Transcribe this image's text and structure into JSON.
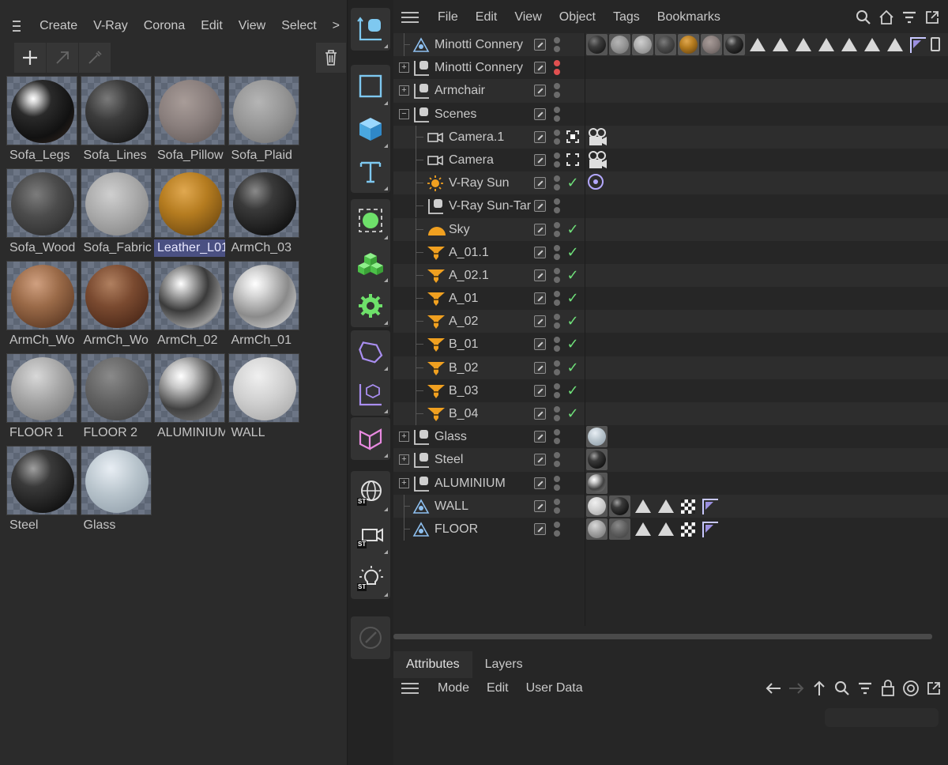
{
  "material_manager": {
    "menu": [
      "Create",
      "V-Ray",
      "Corona",
      "Edit",
      "View",
      "Select"
    ],
    "menu_more": ">",
    "toolbar": {
      "add_icon": "plus-icon",
      "arrow_icon": "arrow-up-right-icon",
      "picker_icon": "eyedropper-icon",
      "trash_icon": "trash-icon"
    },
    "materials": [
      {
        "label": "Sofa_Legs",
        "sphere": "radial-gradient(circle at 35% 30%, #ffffff 0%, #d0d0d0 8%, #2a2a2a 30%, #111 65%, #3a2a20 100%)"
      },
      {
        "label": "Sofa_Lines",
        "sphere": "radial-gradient(circle at 35% 30%, #7a7a7a 0%, #3c3c3c 35%, #1a1a1a 80%)"
      },
      {
        "label": "Sofa_Pillow",
        "sphere": "radial-gradient(circle at 40% 35%, #a89c98 0%, #8a7f7d 45%, #5a5250 100%)"
      },
      {
        "label": "Sofa_Plaid",
        "sphere": "radial-gradient(circle at 40% 35%, #b5b5b5 0%, #979797 45%, #6a6a6a 100%)"
      },
      {
        "label": "Sofa_Wood",
        "sphere": "radial-gradient(circle at 40% 35%, #7c7c7c 0%, #4c4c4c 40%, #232323 100%)"
      },
      {
        "label": "Sofa_Fabric",
        "sphere": "radial-gradient(circle at 40% 35%, #cfcfcf 0%, #aaaaaa 45%, #7a7a7a 100%)"
      },
      {
        "label": "Leather_L01",
        "sphere": "radial-gradient(circle at 40% 30%, #e0a850 0%, #b57c20 40%, #5a3a0c 100%)",
        "selected": true
      },
      {
        "label": "ArmCh_03",
        "sphere": "radial-gradient(circle at 35% 30%, #8a8a8a 0%, #3a3a3a 30%, #151515 75%)"
      },
      {
        "label": "ArmCh_Wo",
        "sphere": "radial-gradient(circle at 40% 30%, #d0a080 0%, #9a6a48 40%, #4a2a18 100%)"
      },
      {
        "label": "ArmCh_Wo",
        "sphere": "radial-gradient(circle at 40% 30%, #b08060 0%, #7a4a30 40%, #3a1c10 100%)"
      },
      {
        "label": "ArmCh_02",
        "sphere": "radial-gradient(circle at 35% 30%, #ffffff 0%, #bdbdbd 15%, #3a3a3a 45%, #9a9a9a 75%, #222 100%)"
      },
      {
        "label": "ArmCh_01",
        "sphere": "radial-gradient(circle at 35% 30%, #ffffff 0%, #d8d8d8 20%, #8a8a8a 55%, #cacaca 85%, #555 100%)"
      },
      {
        "label": "FLOOR 1",
        "sphere": "radial-gradient(circle at 40% 30%, #d8d8d8 0%, #a4a4a4 45%, #6c6c6c 100%)"
      },
      {
        "label": "FLOOR 2",
        "sphere": "radial-gradient(circle at 40% 30%, #8a8a8a 0%, #626262 45%, #3a3a3a 100%)"
      },
      {
        "label": "ALUMINIUM",
        "sphere": "radial-gradient(circle at 35% 30%, #ffffff 0%, #c8c8c8 20%, #404040 55%, #8a8a8a 100%)"
      },
      {
        "label": "WALL",
        "sphere": "radial-gradient(circle at 40% 30%, #f0f0f0 0%, #d0d0d0 45%, #a0a0a0 100%)"
      },
      {
        "label": "Steel",
        "sphere": "radial-gradient(circle at 35% 30%, #a0a0a0 0%, #3a3a3a 30%, #111 80%)"
      },
      {
        "label": "Glass",
        "sphere": "radial-gradient(circle at 40% 30%, #e8eef4 0%, #b8c4cc 45%, #8a98a4 100%)"
      }
    ]
  },
  "palette": {
    "groups": [
      [
        "null-object-icon"
      ],
      [
        "square-spline-icon",
        "cube-icon",
        "text-icon"
      ],
      [
        "deformer-select-icon",
        "cloner-icon",
        "gear-effector-icon"
      ],
      [
        "field-icon",
        "volume-icon"
      ],
      [
        "bend-deformer-icon"
      ],
      [
        "globe-st-icon",
        "camera-st-icon",
        "light-st-icon"
      ],
      [
        "pen-disabled-icon"
      ]
    ],
    "st_label": "ST"
  },
  "object_manager": {
    "menu": [
      "File",
      "Edit",
      "View",
      "Object",
      "Tags",
      "Bookmarks"
    ],
    "right_icons": [
      "search-icon",
      "home-icon",
      "filter-icon",
      "external-window-icon"
    ],
    "rows": [
      {
        "name": "Minotti Connery",
        "indent": 0,
        "expand": "",
        "icon": "polygon",
        "check": "",
        "tags": "minotti",
        "dot": ""
      },
      {
        "name": "Minotti Connery",
        "indent": 0,
        "expand": "+",
        "icon": "null",
        "check": "",
        "tags": "",
        "dot": "red"
      },
      {
        "name": "Armchair",
        "indent": 0,
        "expand": "+",
        "icon": "null",
        "check": "",
        "tags": "",
        "dot": ""
      },
      {
        "name": "Scenes",
        "indent": 0,
        "expand": "−",
        "icon": "null",
        "check": "",
        "tags": "",
        "dot": ""
      },
      {
        "name": "Camera.1",
        "indent": 1,
        "expand": "",
        "icon": "camera",
        "check": "target-active",
        "tags": "camera",
        "dot": ""
      },
      {
        "name": "Camera",
        "indent": 1,
        "expand": "",
        "icon": "camera",
        "check": "target",
        "tags": "camera",
        "dot": ""
      },
      {
        "name": "V-Ray Sun",
        "indent": 1,
        "expand": "",
        "icon": "sun",
        "check": "✓",
        "tags": "sun",
        "dot": ""
      },
      {
        "name": "V-Ray Sun-Tar",
        "indent": 1,
        "expand": "",
        "icon": "null",
        "check": "",
        "tags": "",
        "dot": ""
      },
      {
        "name": "Sky",
        "indent": 1,
        "expand": "",
        "icon": "sky",
        "check": "✓",
        "tags": "",
        "dot": ""
      },
      {
        "name": "A_01.1",
        "indent": 1,
        "expand": "",
        "icon": "light",
        "check": "✓",
        "tags": "",
        "dot": ""
      },
      {
        "name": "A_02.1",
        "indent": 1,
        "expand": "",
        "icon": "light",
        "check": "✓",
        "tags": "",
        "dot": ""
      },
      {
        "name": "A_01",
        "indent": 1,
        "expand": "",
        "icon": "light",
        "check": "✓",
        "tags": "",
        "dot": ""
      },
      {
        "name": "A_02",
        "indent": 1,
        "expand": "",
        "icon": "light",
        "check": "✓",
        "tags": "",
        "dot": ""
      },
      {
        "name": "B_01",
        "indent": 1,
        "expand": "",
        "icon": "light",
        "check": "✓",
        "tags": "",
        "dot": ""
      },
      {
        "name": "B_02",
        "indent": 1,
        "expand": "",
        "icon": "light",
        "check": "✓",
        "tags": "",
        "dot": ""
      },
      {
        "name": "B_03",
        "indent": 1,
        "expand": "",
        "icon": "light",
        "check": "✓",
        "tags": "",
        "dot": ""
      },
      {
        "name": "B_04",
        "indent": 1,
        "expand": "",
        "icon": "light",
        "check": "✓",
        "tags": "",
        "dot": ""
      },
      {
        "name": "Glass",
        "indent": 0,
        "expand": "+",
        "icon": "null",
        "check": "",
        "tags": "glass",
        "dot": ""
      },
      {
        "name": "Steel",
        "indent": 0,
        "expand": "+",
        "icon": "null",
        "check": "",
        "tags": "steel",
        "dot": ""
      },
      {
        "name": "ALUMINIUM",
        "indent": 0,
        "expand": "+",
        "icon": "null",
        "check": "",
        "tags": "alu",
        "dot": ""
      },
      {
        "name": "WALL",
        "indent": 0,
        "expand": "",
        "icon": "polygon",
        "check": "",
        "tags": "wall",
        "dot": ""
      },
      {
        "name": "FLOOR",
        "indent": 0,
        "expand": "",
        "icon": "polygon",
        "check": "",
        "tags": "floor",
        "dot": ""
      }
    ]
  },
  "attributes": {
    "tabs": [
      "Attributes",
      "Layers"
    ],
    "active_tab": "Attributes",
    "menu": [
      "Mode",
      "Edit",
      "User Data"
    ],
    "right_icons": [
      "back-arrow-icon",
      "forward-arrow-icon",
      "up-arrow-icon",
      "search-icon",
      "filter-icon",
      "lock-icon",
      "target-icon",
      "external-window-icon"
    ]
  },
  "colors": {
    "accent": "#9b7ee8",
    "selected_label_bg": "#4a5082",
    "check_green": "#6fe07a",
    "light_orange": "#f0a020"
  }
}
